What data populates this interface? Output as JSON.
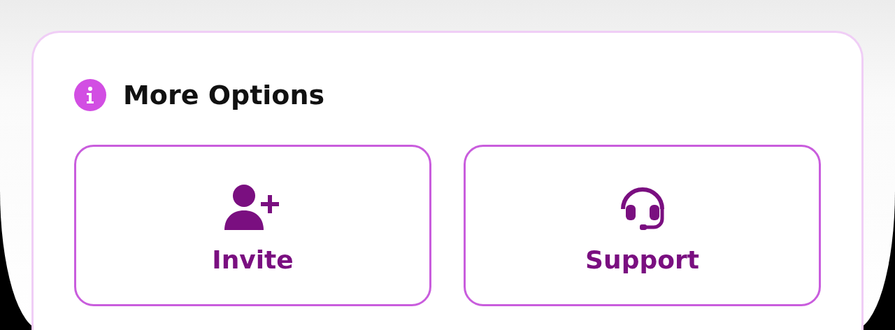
{
  "section": {
    "title": "More Options"
  },
  "actions": [
    {
      "kind": "invite",
      "label": "Invite"
    },
    {
      "kind": "support",
      "label": "Support"
    }
  ]
}
